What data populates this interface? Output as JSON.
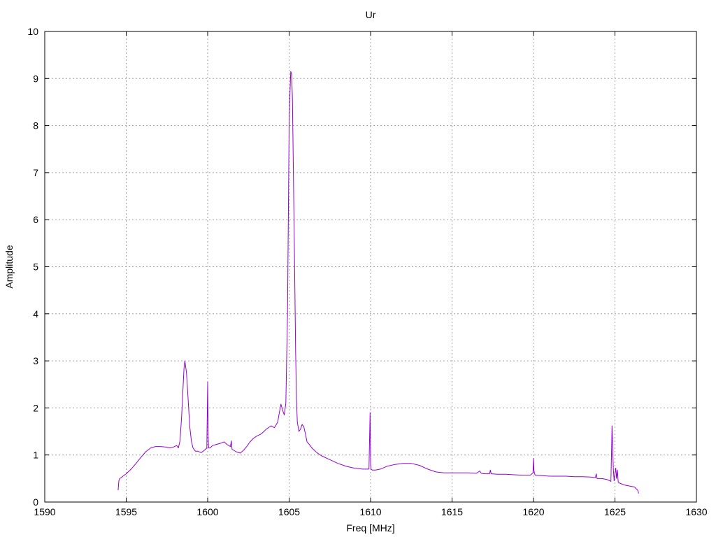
{
  "chart_data": {
    "type": "line",
    "title": "Ur",
    "xlabel": "Freq [MHz]",
    "ylabel": "Amplitude",
    "xlim": [
      1590,
      1630
    ],
    "ylim": [
      0,
      10
    ],
    "xticks": [
      1590,
      1595,
      1600,
      1605,
      1610,
      1615,
      1620,
      1625,
      1630
    ],
    "yticks": [
      0,
      1,
      2,
      3,
      4,
      5,
      6,
      7,
      8,
      9,
      10
    ],
    "grid": true,
    "series": [
      {
        "color": "#9400d3",
        "x": [
          1594.5,
          1594.55,
          1594.6,
          1594.7,
          1594.8,
          1595.0,
          1595.3,
          1595.6,
          1595.9,
          1596.2,
          1596.5,
          1596.8,
          1597.1,
          1597.4,
          1597.7,
          1597.9,
          1598.1,
          1598.2,
          1598.3,
          1598.4,
          1598.5,
          1598.55,
          1598.6,
          1598.7,
          1598.8,
          1598.9,
          1599.0,
          1599.1,
          1599.25,
          1599.4,
          1599.6,
          1599.8,
          1599.95,
          1600.0,
          1600.03,
          1600.06,
          1600.15,
          1600.3,
          1600.5,
          1600.8,
          1601.0,
          1601.2,
          1601.4,
          1601.45,
          1601.5,
          1601.6,
          1601.8,
          1602.0,
          1602.2,
          1602.4,
          1602.6,
          1602.8,
          1603.0,
          1603.3,
          1603.6,
          1603.9,
          1604.1,
          1604.3,
          1604.4,
          1604.5,
          1604.6,
          1604.7,
          1604.8,
          1604.9,
          1605.0,
          1605.05,
          1605.1,
          1605.15,
          1605.2,
          1605.3,
          1605.4,
          1605.45,
          1605.5,
          1605.6,
          1605.7,
          1605.8,
          1605.9,
          1606.0,
          1606.1,
          1606.25,
          1606.4,
          1606.7,
          1607.0,
          1607.5,
          1608.0,
          1608.5,
          1609.0,
          1609.5,
          1609.9,
          1609.97,
          1610.0,
          1610.03,
          1610.1,
          1610.3,
          1610.6,
          1611.0,
          1611.5,
          1612.0,
          1612.5,
          1613.0,
          1613.5,
          1614.0,
          1614.5,
          1615.0,
          1615.5,
          1616.0,
          1616.5,
          1616.7,
          1616.8,
          1617.0,
          1617.3,
          1617.35,
          1617.4,
          1617.8,
          1618.3,
          1618.8,
          1619.3,
          1619.8,
          1619.97,
          1620.0,
          1620.03,
          1620.1,
          1620.5,
          1621.0,
          1621.5,
          1622.0,
          1622.5,
          1623.0,
          1623.5,
          1623.8,
          1623.85,
          1623.9,
          1624.2,
          1624.5,
          1624.75,
          1624.8,
          1624.82,
          1624.85,
          1624.9,
          1624.95,
          1625.0,
          1625.05,
          1625.1,
          1625.15,
          1625.2,
          1625.3,
          1625.6,
          1625.9,
          1626.2,
          1626.4,
          1626.45
        ],
        "y": [
          0.25,
          0.45,
          0.5,
          0.52,
          0.55,
          0.6,
          0.7,
          0.82,
          0.95,
          1.07,
          1.15,
          1.18,
          1.18,
          1.17,
          1.15,
          1.17,
          1.2,
          1.15,
          1.3,
          1.8,
          2.5,
          2.85,
          3.0,
          2.75,
          2.2,
          1.6,
          1.3,
          1.15,
          1.08,
          1.08,
          1.05,
          1.1,
          1.15,
          2.55,
          1.4,
          1.15,
          1.15,
          1.2,
          1.22,
          1.25,
          1.28,
          1.22,
          1.18,
          1.3,
          1.12,
          1.1,
          1.06,
          1.04,
          1.1,
          1.18,
          1.28,
          1.35,
          1.4,
          1.45,
          1.55,
          1.62,
          1.58,
          1.7,
          1.9,
          2.08,
          1.95,
          1.85,
          2.1,
          4.0,
          8.0,
          8.7,
          9.15,
          9.1,
          8.6,
          6.0,
          3.2,
          2.2,
          1.7,
          1.5,
          1.55,
          1.65,
          1.6,
          1.45,
          1.28,
          1.22,
          1.15,
          1.05,
          0.98,
          0.9,
          0.82,
          0.76,
          0.72,
          0.7,
          0.7,
          1.9,
          0.8,
          0.7,
          0.68,
          0.68,
          0.7,
          0.76,
          0.8,
          0.82,
          0.82,
          0.78,
          0.7,
          0.64,
          0.62,
          0.62,
          0.62,
          0.62,
          0.61,
          0.66,
          0.61,
          0.6,
          0.6,
          0.68,
          0.6,
          0.59,
          0.59,
          0.58,
          0.57,
          0.57,
          0.62,
          0.93,
          0.66,
          0.57,
          0.56,
          0.55,
          0.55,
          0.55,
          0.54,
          0.54,
          0.53,
          0.52,
          0.6,
          0.5,
          0.5,
          0.48,
          0.44,
          1.2,
          1.62,
          1.25,
          0.7,
          0.45,
          0.6,
          0.72,
          0.5,
          0.68,
          0.42,
          0.4,
          0.36,
          0.34,
          0.32,
          0.25,
          0.18
        ]
      }
    ]
  }
}
